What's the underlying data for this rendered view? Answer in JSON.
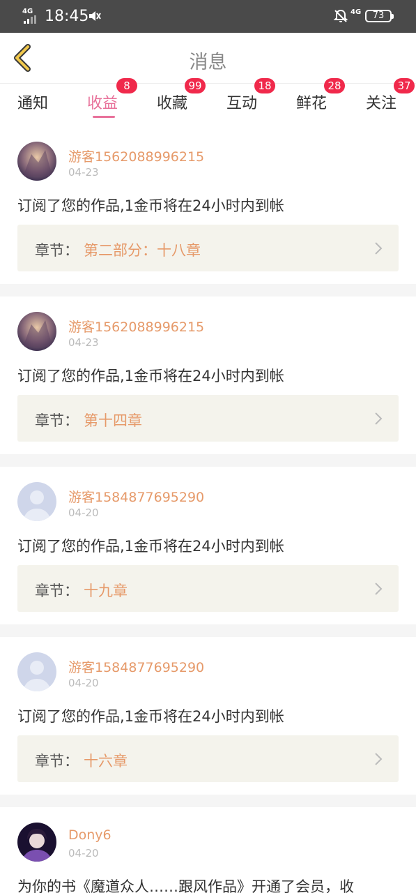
{
  "status_bar": {
    "network_left": "4G",
    "time": "18:45",
    "network_right": "4G",
    "battery": "73"
  },
  "header": {
    "title": "消息",
    "back_icon": "chevron-left-icon"
  },
  "tabs": [
    {
      "label": "通知",
      "badge": ""
    },
    {
      "label": "收益",
      "badge": "8",
      "active": true
    },
    {
      "label": "收藏",
      "badge": "99"
    },
    {
      "label": "互动",
      "badge": "18"
    },
    {
      "label": "鲜花",
      "badge": "28"
    },
    {
      "label": "关注",
      "badge": "37"
    }
  ],
  "messages": [
    {
      "user": "游客1562088996215",
      "date": "04-23",
      "text": "订阅了您的作品,1金币将在24小时内到帐",
      "chapter_label": "章节：",
      "chapter": "第二部分：十八章"
    },
    {
      "user": "游客1562088996215",
      "date": "04-23",
      "text": "订阅了您的作品,1金币将在24小时内到帐",
      "chapter_label": "章节：",
      "chapter": "第十四章"
    },
    {
      "user": "游客1584877695290",
      "date": "04-20",
      "text": "订阅了您的作品,1金币将在24小时内到帐",
      "chapter_label": "章节：",
      "chapter": "十九章"
    },
    {
      "user": "游客1584877695290",
      "date": "04-20",
      "text": "订阅了您的作品,1金币将在24小时内到帐",
      "chapter_label": "章节：",
      "chapter": "十六章"
    },
    {
      "user": "Dony6",
      "date": "04-20",
      "text": "为你的书《魔道众人……跟风作品》开通了会员，收"
    }
  ],
  "colors": {
    "accent_pink": "#e8719a",
    "badge_red": "#f0294b",
    "username_orange": "#e69a6a",
    "status_bar": "#4a4a4a"
  }
}
